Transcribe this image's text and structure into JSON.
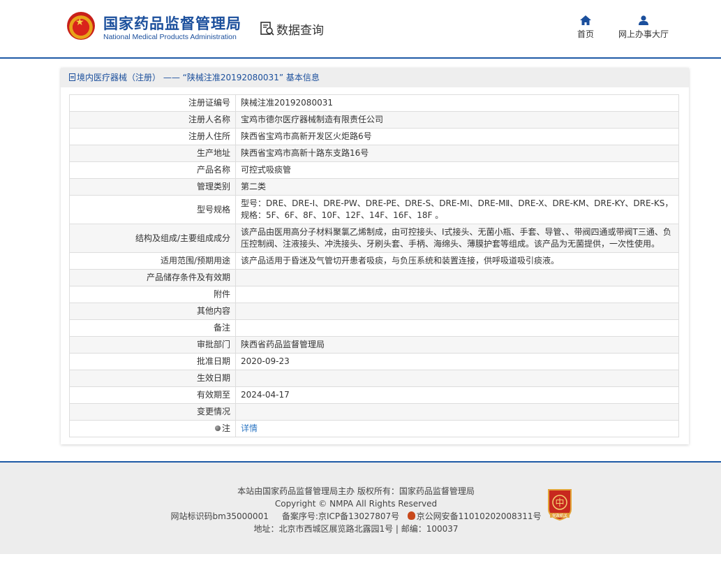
{
  "header": {
    "title": "国家药品监督管理局",
    "subtitle": "National Medical Products Administration",
    "section": "数据查询",
    "nav": [
      {
        "label": "首页",
        "icon": "home-icon"
      },
      {
        "label": "网上办事大厅",
        "icon": "user-icon"
      }
    ]
  },
  "panel": {
    "heading": "境内医疗器械（注册） —— “陕械注准20192080031” 基本信息"
  },
  "rows": [
    {
      "key": "注册证编号",
      "value": "陕械注准20192080031"
    },
    {
      "key": "注册人名称",
      "value": "宝鸡市德尔医疗器械制造有限责任公司"
    },
    {
      "key": "注册人住所",
      "value": "陕西省宝鸡市高新开发区火炬路6号"
    },
    {
      "key": "生产地址",
      "value": "陕西省宝鸡市高新十路东支路16号"
    },
    {
      "key": "产品名称",
      "value": "可控式吸痰管"
    },
    {
      "key": "管理类别",
      "value": "第二类"
    },
    {
      "key": "型号规格",
      "value": "型号：DRE、DRE-I、DRE-PW、DRE-PE、DRE-S、DRE-MⅠ、DRE-MⅡ、DRE-X、DRE-KM、DRE-KY、DRE-KS，规格：5F、6F、8F、10F、12F、14F、16F、18F 。"
    },
    {
      "key": "结构及组成/主要组成成分",
      "value": "该产品由医用高分子材料聚氯乙烯制成，由可控接头、I式接头、无菌小瓶、手套、导管、、带阀四通或带阀T三通、负压控制阀、注液接头、冲洗接头、牙刷头套、手柄、海绵头、薄膜护套等组成。该产品为无菌提供，一次性使用。"
    },
    {
      "key": "适用范围/预期用途",
      "value": "该产品适用于昏迷及气管切开患者吸痰，与负压系统和装置连接，供呼吸道吸引痰液。"
    },
    {
      "key": "产品储存条件及有效期",
      "value": ""
    },
    {
      "key": "附件",
      "value": ""
    },
    {
      "key": "其他内容",
      "value": ""
    },
    {
      "key": "备注",
      "value": ""
    },
    {
      "key": "审批部门",
      "value": "陕西省药品监督管理局"
    },
    {
      "key": "批准日期",
      "value": "2020-09-23"
    },
    {
      "key": "生效日期",
      "value": ""
    },
    {
      "key": "有效期至",
      "value": "2024-04-17"
    },
    {
      "key": "变更情况",
      "value": ""
    },
    {
      "key": "注",
      "value": "详情"
    }
  ],
  "footer": {
    "line1": "本站由国家药品监督管理局主办 版权所有：国家药品监督管理局",
    "line2": "Copyright © NMPA All Rights Reserved",
    "line3a": "网站标识码bm35000001     备案序号:京ICP备13027807号",
    "line3b": "京公网安备11010202008311号",
    "line4": "地址：北京市西城区展览路北露园1号 | 邮编：100037",
    "badge_label": "党政机关"
  },
  "colors": {
    "brand": "#1b4f9c",
    "link": "#2f78c4",
    "footer_bg": "#ededed"
  }
}
